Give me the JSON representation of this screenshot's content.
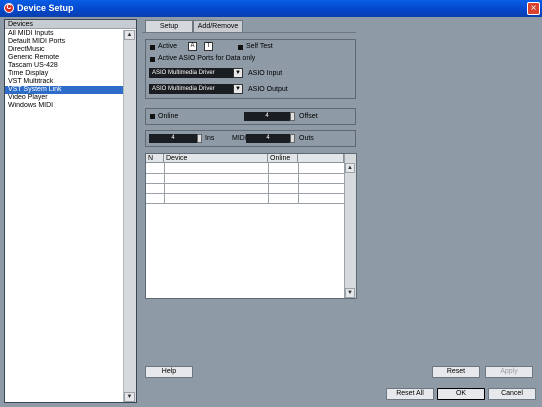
{
  "window": {
    "title": "Device Setup",
    "app_icon": "cubase-icon",
    "close_icon": "close-icon",
    "close_label": "×"
  },
  "devices": {
    "header": "Devices",
    "items": [
      "All MIDI Inputs",
      "Default MIDI Ports",
      "DirectMusic",
      "Generic Remote",
      "Tascam US-428",
      "Time Display",
      "VST Multitrack",
      "VST System Link",
      "Video Player",
      "Windows MIDI"
    ],
    "selected_index": 7
  },
  "tabs": [
    {
      "label": "Setup"
    },
    {
      "label": "Add/Remove"
    }
  ],
  "setup": {
    "active_label": "Active",
    "a_label": "A",
    "t_label": "T",
    "self_test_label": "Self Test",
    "active_asio_label": "Active ASIO Ports for  Data only",
    "asio_input": {
      "value": "ASIO Multimedia Driver",
      "label": "ASIO Input"
    },
    "asio_output": {
      "value": "ASIO Multimedia Driver",
      "label": "ASIO Output"
    },
    "online_label": "Online",
    "offset_value": "4",
    "offset_label": "Offset",
    "ins_value": "4",
    "ins_label": "Ins",
    "midi_label": "MIDI",
    "outs_value": "4",
    "outs_label": "Outs"
  },
  "table": {
    "columns": [
      "N",
      "Device",
      "Online",
      ""
    ]
  },
  "buttons": {
    "help": "Help",
    "reset": "Reset",
    "apply": "Apply",
    "reset_all": "Reset All",
    "ok": "OK",
    "cancel": "Cancel"
  },
  "colors": {
    "titlebar": "#0a52dd",
    "selection": "#2d6cc8",
    "background": "#8e9aa6"
  }
}
